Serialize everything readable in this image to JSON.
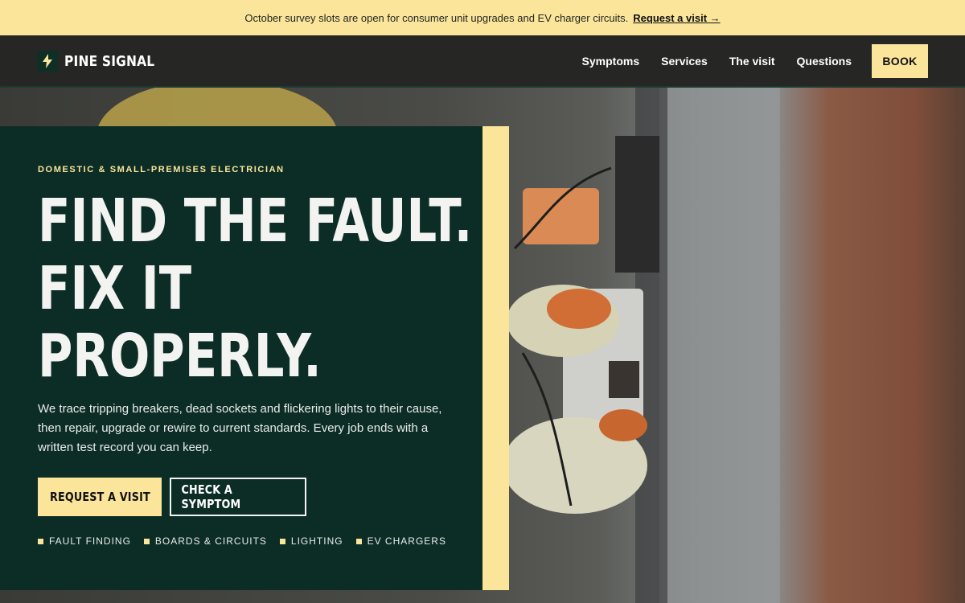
{
  "announcement": {
    "text": "October survey slots are open for consumer unit upgrades and EV charger circuits.",
    "link_label": "Request a visit →"
  },
  "brand": {
    "name": "PINE SIGNAL",
    "icon": "lightning-bolt-icon"
  },
  "nav": {
    "items": [
      {
        "label": "Symptoms"
      },
      {
        "label": "Services"
      },
      {
        "label": "The visit"
      },
      {
        "label": "Questions"
      }
    ],
    "book_label": "BOOK"
  },
  "hero": {
    "kicker": "DOMESTIC & SMALL-PREMISES ELECTRICIAN",
    "headline_lines": [
      "FIND THE FAULT.",
      "FIX IT",
      "PROPERLY."
    ],
    "lede": "We trace tripping breakers, dead sockets and flickering lights to their cause, then repair, upgrade or rewire to current standards. Every job ends with a written test record you can keep.",
    "primary_cta": "REQUEST A VISIT",
    "secondary_cta": "CHECK A SYMPTOM",
    "tags": [
      "FAULT FINDING",
      "BOARDS & CIRCUITS",
      "LIGHTING",
      "EV CHARGERS"
    ]
  },
  "colors": {
    "accent": "#fbe59b",
    "panel": "#0c2d26",
    "header": "#262624"
  }
}
